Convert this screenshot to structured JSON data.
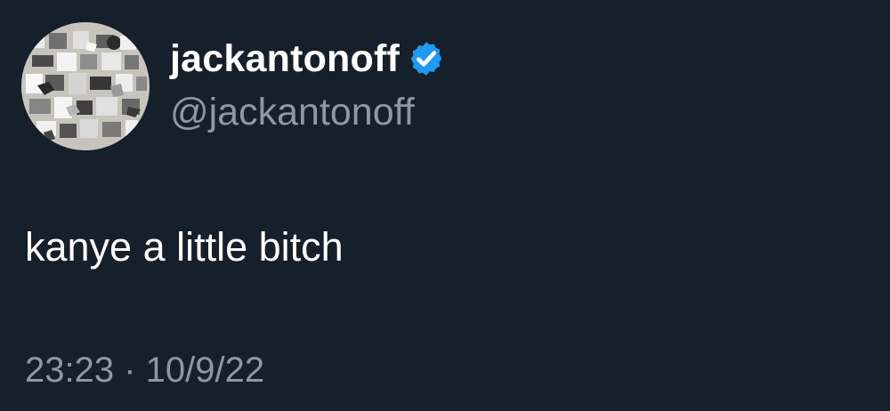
{
  "tweet": {
    "display_name": "jackantonoff",
    "handle": "@jackantonoff",
    "verified": true,
    "text": "kanye a little bitch",
    "timestamp": "23:23 · 10/9/22"
  },
  "icons": {
    "avatar": "avatar-image",
    "verified_badge": "verified-badge-icon"
  },
  "colors": {
    "background": "#15202b",
    "primary_text": "#ffffff",
    "secondary_text": "#8b98a5",
    "verified_blue": "#1d9bf0"
  }
}
